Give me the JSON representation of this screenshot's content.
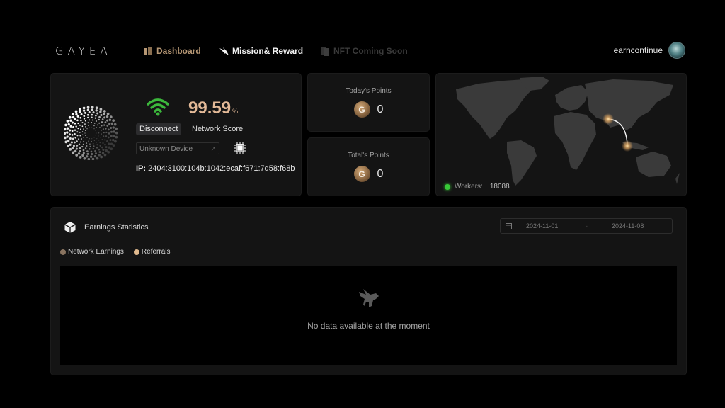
{
  "nav": {
    "logo": "GAYEA",
    "items": [
      {
        "label": "Dashboard",
        "icon": "dashboard-icon",
        "state": "active"
      },
      {
        "label": "Mission& Reward",
        "icon": "eagle-icon",
        "state": "normal"
      },
      {
        "label": "NFT Coming Soon",
        "icon": "cards-icon",
        "state": "disabled"
      }
    ],
    "username": "earncontinue"
  },
  "network": {
    "score": "99.59",
    "score_unit": "%",
    "disconnect_label": "Disconnect",
    "score_label": "Network Score",
    "device_placeholder": "Unknown Device",
    "ip_label": "IP:",
    "ip_value": "2404:3100:104b:1042:ecaf:f671:7d58:f68b",
    "wifi_color": "#3cb83c",
    "score_color": "#e3b997"
  },
  "points": {
    "today_label": "Today's Points",
    "today_value": "0",
    "total_label": "Total's Points",
    "total_value": "0",
    "coin_glyph": "G"
  },
  "map": {
    "workers_label": "Workers:",
    "workers_value": "18088",
    "status_color": "#37c837"
  },
  "earnings": {
    "title": "Earnings Statistics",
    "legend": [
      {
        "label": "Network Earnings",
        "color": "#8a7460"
      },
      {
        "label": "Referrals",
        "color": "#e0b98e"
      }
    ],
    "date_start": "2024-11-01",
    "date_sep": "-",
    "date_end": "2024-11-08",
    "empty_message": "No data available at the moment"
  }
}
